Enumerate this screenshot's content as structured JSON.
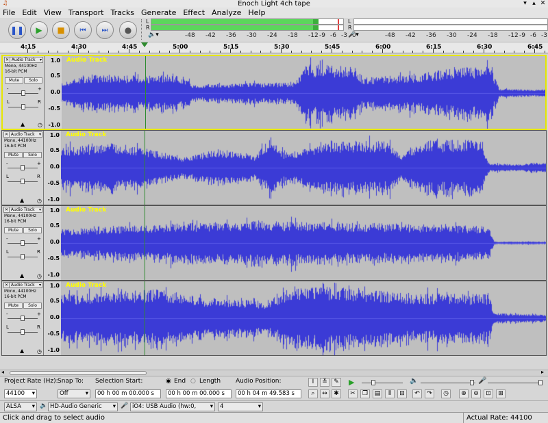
{
  "window": {
    "title": "Enoch Light 4ch tape"
  },
  "menu": [
    "File",
    "Edit",
    "View",
    "Transport",
    "Tracks",
    "Generate",
    "Effect",
    "Analyze",
    "Help"
  ],
  "transport": {
    "pause": "pause-icon",
    "play": "play-icon",
    "stop": "stop-icon",
    "skip_start": "skip-to-start-icon",
    "skip_end": "skip-to-end-icon",
    "record": "record-icon"
  },
  "meters": {
    "playback": {
      "channel_left": "L",
      "channel_right": "R",
      "scale": [
        "-48",
        "-42",
        "-36",
        "-30",
        "-24",
        "-18",
        "-12",
        "-9",
        "-6",
        "-3",
        "0"
      ],
      "left_level": 0.87,
      "right_level": 0.87,
      "color": "#5cd65c"
    },
    "record": {
      "channel_left": "L",
      "channel_right": "R",
      "scale": [
        "-48",
        "-42",
        "-36",
        "-30",
        "-24",
        "-18",
        "-12",
        "-9",
        "-6",
        "-3",
        "0"
      ]
    }
  },
  "timeline": {
    "labels": [
      "4:15",
      "4:30",
      "4:45",
      "5:00",
      "5:15",
      "5:30",
      "5:45",
      "6:00",
      "6:15",
      "6:30",
      "6:45"
    ]
  },
  "tracks": [
    {
      "name": "Audio Track",
      "info1": "Mono, 44100Hz",
      "info2": "16-bit PCM",
      "mute": "Mute",
      "solo": "Solo",
      "pan_l": "L",
      "pan_r": "R",
      "scale": [
        "1.0",
        "0.5",
        "0.0",
        "-0.5",
        "-1.0"
      ],
      "selected": true
    },
    {
      "name": "Audio Track",
      "info1": "Mono, 44100Hz",
      "info2": "16-bit PCM",
      "mute": "Mute",
      "solo": "Solo",
      "pan_l": "L",
      "pan_r": "R",
      "scale": [
        "1.0",
        "0.5",
        "0.0",
        "-0.5",
        "-1.0"
      ],
      "selected": false
    },
    {
      "name": "Audio Track",
      "info1": "Mono, 44100Hz",
      "info2": "16-bit PCM",
      "mute": "Mute",
      "solo": "Solo",
      "pan_l": "L",
      "pan_r": "R",
      "scale": [
        "1.0",
        "0.5",
        "0.0",
        "-0.5",
        "-1.0"
      ],
      "selected": false
    },
    {
      "name": "Audio Track",
      "info1": "Mono, 44100Hz",
      "info2": "16-bit PCM",
      "mute": "Mute",
      "solo": "Solo",
      "pan_l": "L",
      "pan_r": "R",
      "scale": [
        "1.0",
        "0.5",
        "0.0",
        "-0.5",
        "-1.0"
      ],
      "selected": false
    }
  ],
  "selection_bar": {
    "project_rate_label": "Project Rate (Hz):",
    "project_rate_value": "44100",
    "snap_to_label": "Snap To:",
    "snap_to_value": "Off",
    "selection_start_label": "Selection Start:",
    "end_label": "End",
    "length_label": "Length",
    "selection_start_value": "00 h 00 m 00.000 s",
    "selection_end_value": "00 h 00 m 00.000 s",
    "audio_position_label": "Audio Position:",
    "audio_position_value": "00 h 04 m 49.583 s"
  },
  "device_bar": {
    "host": "ALSA",
    "output_device": "HD-Audio Generic",
    "input_device": "iO4: USB Audio (hw:0,",
    "channels": "4"
  },
  "status": {
    "message": "Click and drag to select audio",
    "rate": "Actual Rate: 44100"
  },
  "colors": {
    "waveform": "#3b3bd6",
    "selection_border": "#e6e600",
    "track_name": "#ffff00",
    "playhead": "#2e8b2e"
  }
}
